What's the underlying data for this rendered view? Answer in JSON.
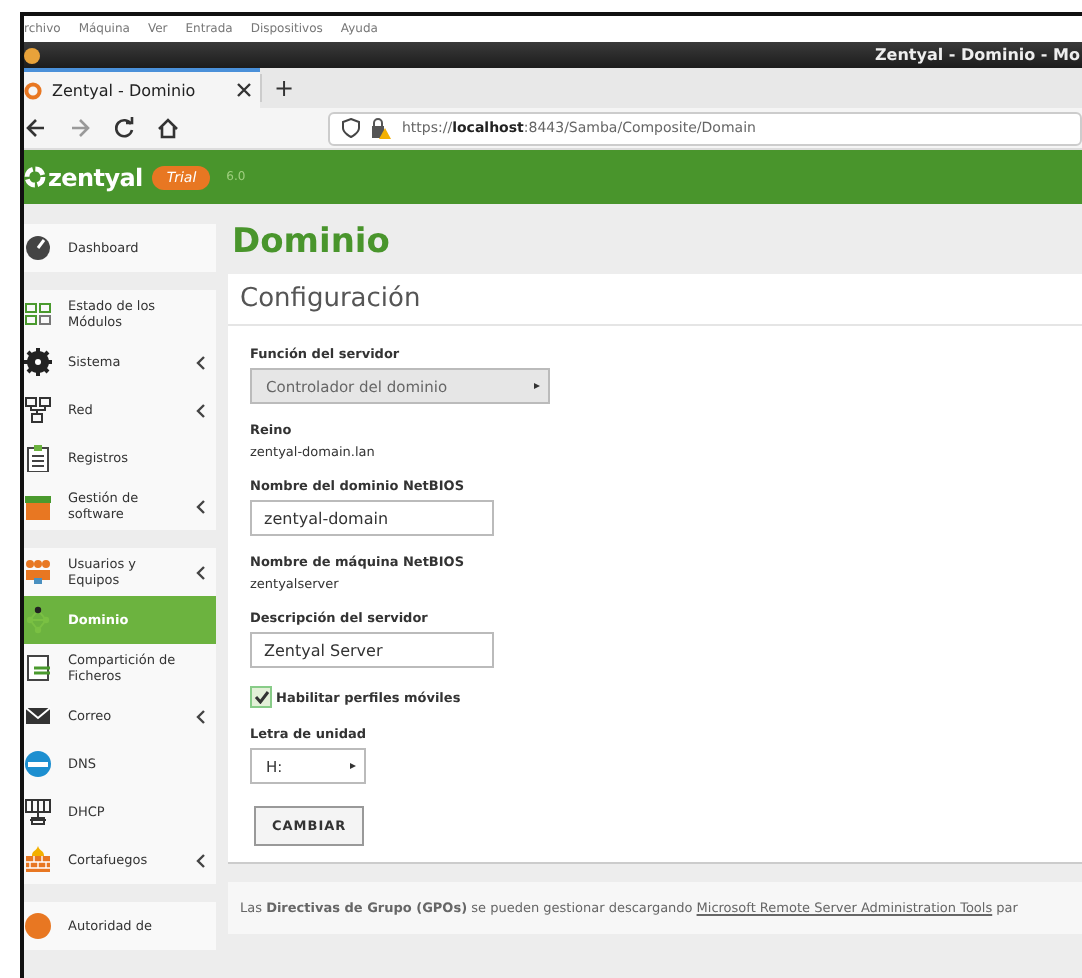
{
  "vm_menu": [
    "rchivo",
    "Máquina",
    "Ver",
    "Entrada",
    "Dispositivos",
    "Ayuda"
  ],
  "window": {
    "title": "Zentyal - Dominio - Mo"
  },
  "browser": {
    "tab": {
      "label": "Zentyal - Dominio",
      "selected": true
    },
    "new_tab": "+",
    "url_prefix": "https://",
    "url_host": "localhost",
    "url_rest": ":8443/Samba/Composite/Domain"
  },
  "header": {
    "logo": "zentyal",
    "badge": "Trial",
    "version": "6.0"
  },
  "sidebar": {
    "groups": [
      [
        {
          "label": "Dashboard",
          "has_submenu": false,
          "selected": false
        }
      ],
      [
        {
          "label": "Estado de los Módulos",
          "has_submenu": false,
          "selected": false
        },
        {
          "label": "Sistema",
          "has_submenu": true,
          "selected": false
        },
        {
          "label": "Red",
          "has_submenu": true,
          "selected": false
        },
        {
          "label": "Registros",
          "has_submenu": false,
          "selected": false
        },
        {
          "label": "Gestión de software",
          "has_submenu": true,
          "selected": false
        }
      ],
      [
        {
          "label": "Usuarios y Equipos",
          "has_submenu": true,
          "selected": false
        },
        {
          "label": "Dominio",
          "has_submenu": false,
          "selected": true
        },
        {
          "label": "Compartición de Ficheros",
          "has_submenu": false,
          "selected": false
        },
        {
          "label": "Correo",
          "has_submenu": true,
          "selected": false
        },
        {
          "label": "DNS",
          "has_submenu": false,
          "selected": false
        },
        {
          "label": "DHCP",
          "has_submenu": false,
          "selected": false
        },
        {
          "label": "Cortafuegos",
          "has_submenu": true,
          "selected": false
        }
      ],
      [
        {
          "label": "Autoridad de",
          "has_submenu": false,
          "selected": false
        }
      ]
    ]
  },
  "page_title": "Dominio",
  "form": {
    "title": "Configuración",
    "fields": [
      {
        "kind": "select",
        "label": "Función del servidor",
        "value": "Controlador del dominio",
        "disabled": true
      },
      {
        "kind": "text",
        "label": "Reino",
        "value": "zentyal-domain.lan"
      },
      {
        "kind": "input",
        "label": "Nombre del dominio NetBIOS",
        "value": "zentyal-domain"
      },
      {
        "kind": "text",
        "label": "Nombre de máquina NetBIOS",
        "value": "zentyalserver"
      },
      {
        "kind": "input",
        "label": "Descripción del servidor",
        "value": "Zentyal Server"
      },
      {
        "kind": "checkbox",
        "label": "Habilitar perfiles móviles",
        "checked": true
      },
      {
        "kind": "select",
        "label": "Letra de unidad",
        "value": "H:",
        "disabled": false
      }
    ],
    "button": "CAMBIAR"
  },
  "note": {
    "text": "Las **Directivas de Grupo (GPOs)** se pueden gestionar descargando",
    "link": "Microsoft Remote Server Administration Tools",
    "tail": "par"
  }
}
